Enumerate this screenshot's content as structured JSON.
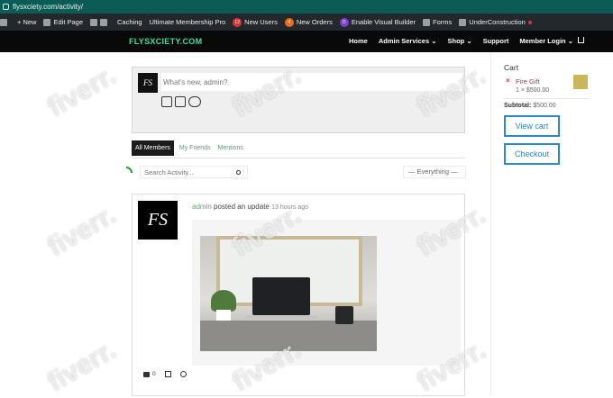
{
  "browser": {
    "url": "flysxciety.com/activity/"
  },
  "admin_bar": {
    "new_label": "New",
    "edit_page": "Edit Page",
    "caching": "Caching",
    "plugin": "Ultimate Membership Pro",
    "new_users_count": "12",
    "new_users": "New Users",
    "new_orders_count": "4",
    "new_orders": "New Orders",
    "visual_builder": "Enable Visual Builder",
    "forms": "Forms",
    "under_construction": "UnderConstruction"
  },
  "site": {
    "logo": "FLYSXCIETY.COM",
    "menu": [
      "Home",
      "Admin Services ⌄",
      "Shop ⌄",
      "Support",
      "Member Login ⌄"
    ]
  },
  "composer": {
    "avatar_text": "FS",
    "placeholder": "What's new, admin?"
  },
  "tabs": [
    "All Members",
    "My Friends",
    "Mentions"
  ],
  "filters": {
    "search_placeholder": "Search Activity...",
    "show": "— Everything —"
  },
  "activity": {
    "avatar_text": "FS",
    "user": "admin",
    "action": "posted an update",
    "time": "13 hours ago",
    "comments": "0"
  },
  "cart": {
    "title": "Cart",
    "item_name": "Fire Gift",
    "item_qty": "1 × $500.00",
    "subtotal_label": "Subtotal:",
    "subtotal_value": "$500.00",
    "view_cart": "View cart",
    "checkout": "Checkout"
  },
  "watermark": "fiverr."
}
